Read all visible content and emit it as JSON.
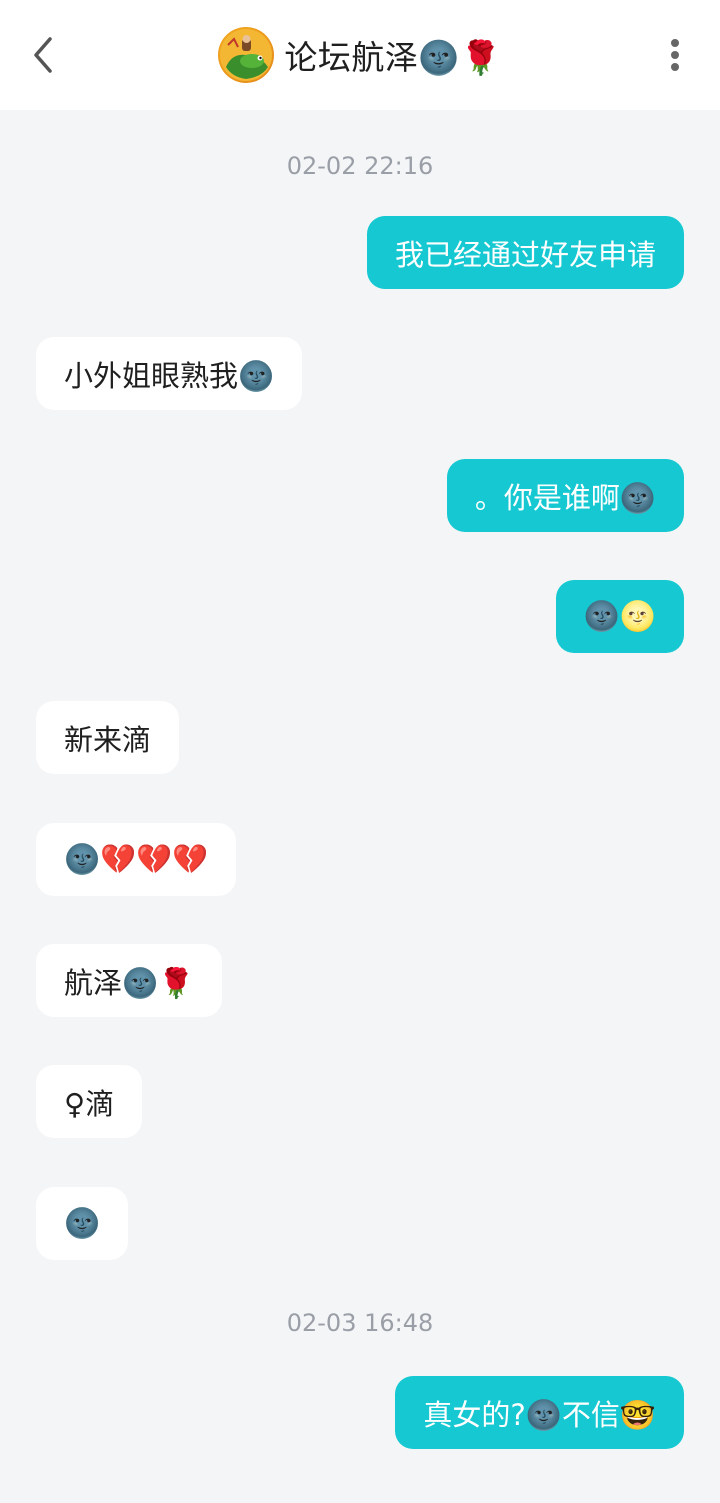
{
  "header": {
    "title": "论坛航泽🌚🌹",
    "back_icon": "chevron-left-icon",
    "more_icon": "more-vertical-icon"
  },
  "chat": {
    "timestamps": [
      "02-02 22:16",
      "02-03 16:48"
    ],
    "messages": [
      {
        "side": "out",
        "text": "我已经通过好友申请"
      },
      {
        "side": "in",
        "text": "小外姐眼熟我🌚"
      },
      {
        "side": "out",
        "text": "。你是谁啊🌚"
      },
      {
        "side": "out",
        "text": "🌚🌝"
      },
      {
        "side": "in",
        "text": "新来滴"
      },
      {
        "side": "in",
        "text": "🌚💔💔💔"
      },
      {
        "side": "in",
        "text": "航泽🌚🌹"
      },
      {
        "side": "in",
        "text": "♀滴"
      },
      {
        "side": "in",
        "text": "🌚"
      },
      {
        "side": "out",
        "text": "真女的?🌚不信🤓"
      }
    ]
  },
  "colors": {
    "outgoing_bubble": "#16c8d1",
    "incoming_bubble": "#ffffff",
    "background": "#f4f5f7",
    "timestamp": "#9a9ea6"
  }
}
